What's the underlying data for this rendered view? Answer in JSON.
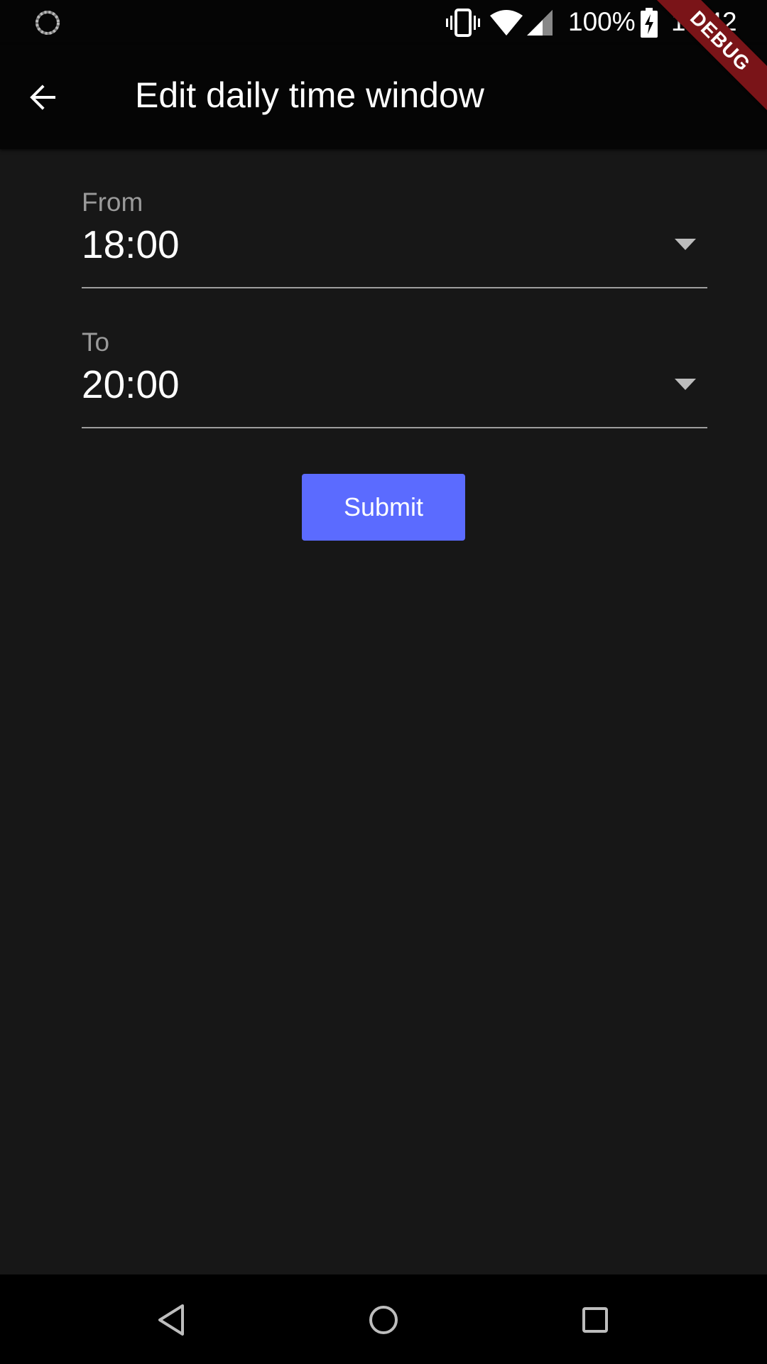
{
  "status_bar": {
    "battery_percent": "100%",
    "time": "19:42",
    "icons": [
      "loading-spinner-icon",
      "vibrate-icon",
      "wifi-icon",
      "cell-signal-icon",
      "battery-charging-icon"
    ]
  },
  "debug_banner": {
    "label": "DEBUG",
    "color": "#7a1418"
  },
  "app_bar": {
    "title": "Edit daily time window",
    "back_icon": "arrow-back-icon"
  },
  "form": {
    "from": {
      "label": "From",
      "value": "18:00"
    },
    "to": {
      "label": "To",
      "value": "20:00"
    },
    "submit_label": "Submit",
    "accent_color": "#5b6bff"
  },
  "nav_bar": {
    "icons": [
      "nav-back-icon",
      "nav-home-icon",
      "nav-recents-icon"
    ]
  }
}
